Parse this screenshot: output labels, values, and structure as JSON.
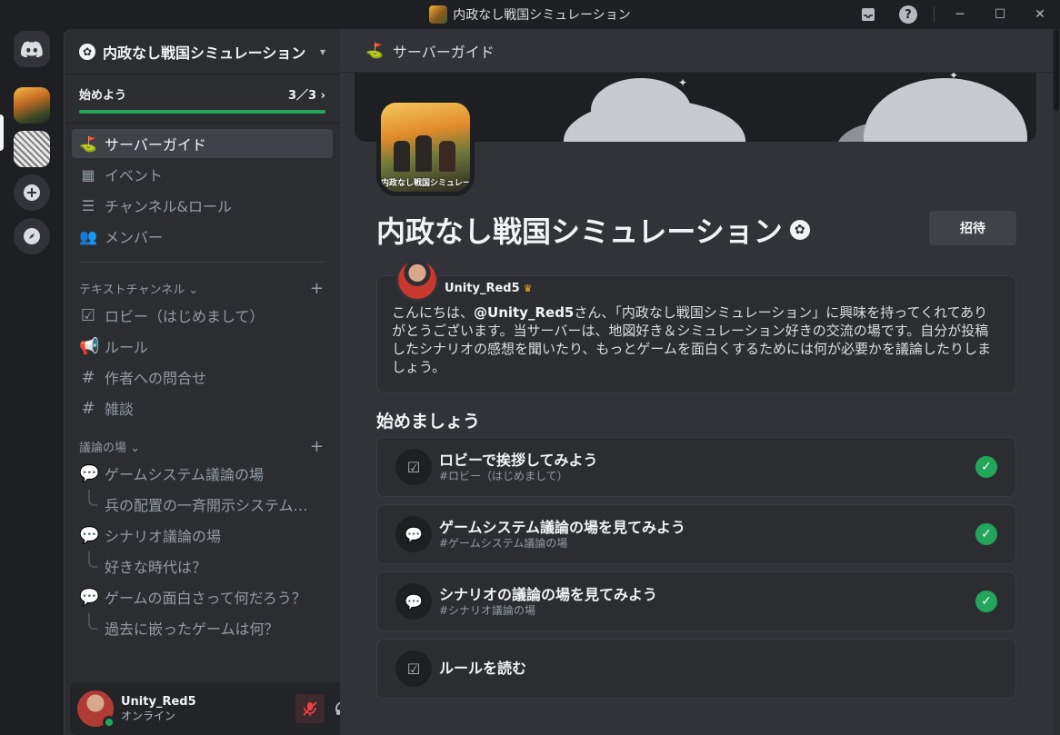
{
  "window": {
    "title": "内政なし戦国シミュレーション"
  },
  "guild": {
    "name": "内政なし戦国シミュレーション",
    "onboarding_label": "始めよう",
    "onboarding_progress": "3／3",
    "onboarding_fraction": 1.0
  },
  "nav": {
    "server_guide": "サーバーガイド",
    "events": "イベント",
    "channels_roles": "チャンネル&ロール",
    "members": "メンバー"
  },
  "categories": {
    "text": "テキストチャンネル",
    "debate": "議論の場"
  },
  "channels": {
    "lobby": "ロビー（はじめまして）",
    "rules": "ルール",
    "contact": "作者への問合せ",
    "chat": "雑談",
    "game_system": "ゲームシステム議論の場",
    "game_system_thread": "兵の配置の一斉開示システムっ...",
    "scenario": "シナリオ議論の場",
    "scenario_thread": "好きな時代は？",
    "fun": "ゲームの面白さって何だろう？",
    "fun_thread": "過去に嵌ったゲームは何？"
  },
  "user": {
    "name": "Unity_Red5",
    "status": "オンライン"
  },
  "main": {
    "header_title": "サーバーガイド",
    "server_icon_caption": "内政なし戦国シミュレーション",
    "invite_label": "招待",
    "welcome_author": "Unity_Red5",
    "welcome_prefix": "こんにちは、",
    "welcome_mention": "@Unity_Red5",
    "welcome_body": "さん、「内政なし戦国シミュレーション」に興味を持ってくれてありがとうございます。当サーバーは、地図好き＆シミュレーション好きの交流の場です。自分が投稿したシナリオの感想を聞いたり、もっとゲームを面白くするためには何が必要かを議論したりしましょう。",
    "getting_started": "始めましょう",
    "tasks": [
      {
        "title": "ロビーで挨拶してみよう",
        "sub": "#ロビー（はじめまして）",
        "done": true
      },
      {
        "title": "ゲームシステム議論の場を見てみよう",
        "sub": "#ゲームシステム議論の場",
        "done": true
      },
      {
        "title": "シナリオの議論の場を見てみよう",
        "sub": "#シナリオ議論の場",
        "done": true
      },
      {
        "title": "ルールを読む",
        "sub": "",
        "done": false
      }
    ]
  },
  "colors": {
    "accent_green": "#23a55a",
    "muted_red": "#f23f42",
    "crown": "#f0b132"
  }
}
